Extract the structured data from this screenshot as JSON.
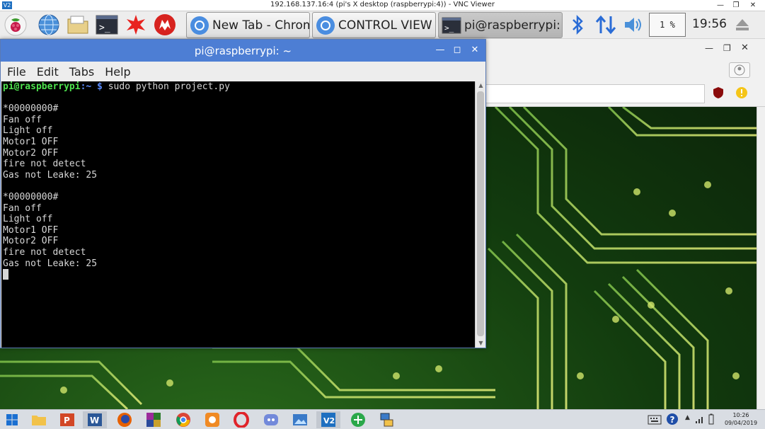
{
  "vnc": {
    "title": "192.168.137.16:4 (pi's X desktop (raspberrypi:4)) - VNC Viewer",
    "logo": "V2",
    "minimize": "—",
    "restore": "❐",
    "close": "✕"
  },
  "pi_panel": {
    "launchers": [
      "raspberry-menu-icon",
      "web-browser-icon",
      "file-manager-icon",
      "terminal-icon",
      "wolfram-icon",
      "mathematica-icon"
    ],
    "tasks": [
      {
        "label": "New Tab - Chrom...",
        "icon": "chromium-icon"
      },
      {
        "label": "CONTROL VIEW -...",
        "icon": "chromium-icon"
      },
      {
        "label": "pi@raspberrypi: ~",
        "icon": "terminal-icon"
      }
    ],
    "cpu_usage": "1 %",
    "clock": "19:56"
  },
  "chrome_bg": {
    "min": "—",
    "restore": "❐",
    "close": "✕"
  },
  "terminal": {
    "title": "pi@raspberrypi: ~",
    "minimize": "—",
    "maximize": "◻",
    "close": "✕",
    "menu": [
      "File",
      "Edit",
      "Tabs",
      "Help"
    ],
    "prompt_user": "pi@raspberrypi",
    "prompt_path": ":~ $",
    "command": " sudo python project.py",
    "lines": [
      "",
      "*00000000#",
      "Fan off",
      "Light off",
      "Motor1 OFF",
      "Motor2 OFF",
      "fire not detect",
      "Gas not Leake: 25",
      "",
      "*00000000#",
      "Fan off",
      "Light off",
      "Motor1 OFF",
      "Motor2 OFF",
      "fire not detect",
      "Gas not Leake: 25"
    ]
  },
  "taskbar": {
    "apps": [
      "windows-start-icon",
      "file-explorer-icon",
      "powerpoint-icon",
      "word-icon",
      "firefox-icon",
      "winrar-icon",
      "chrome-icon",
      "uc-browser-icon",
      "opera-icon",
      "discord-icon",
      "photos-icon",
      "vnc-viewer-icon",
      "network-icon",
      "remote-desktop-icon"
    ],
    "time": "10:26",
    "date": "09/04/2019"
  },
  "colors": {
    "terminal_title": "#4d7ed4",
    "prompt_user": "#4ee34e",
    "prompt_path": "#5b8cff"
  }
}
